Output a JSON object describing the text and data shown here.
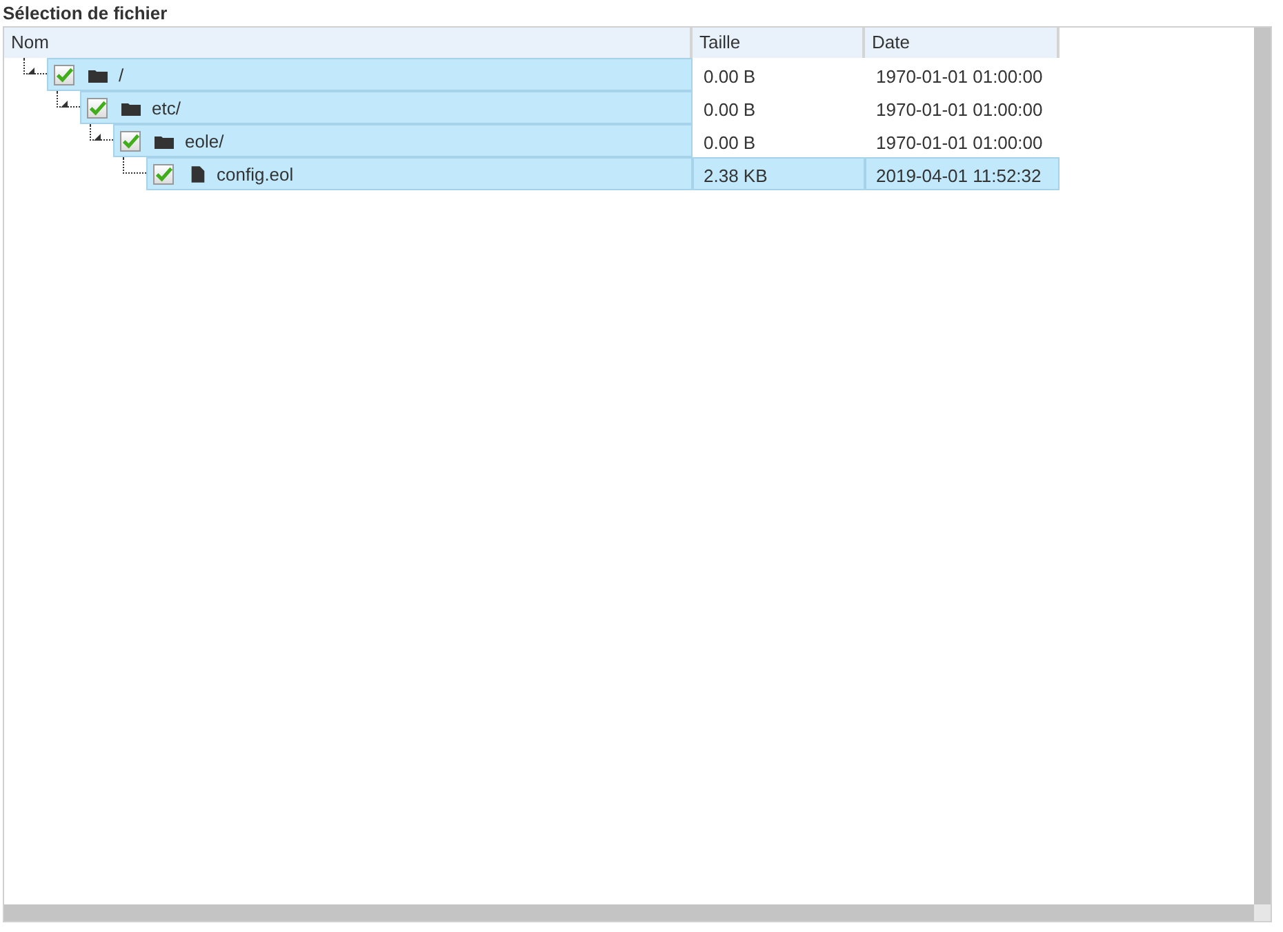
{
  "title": "Sélection de fichier",
  "table": {
    "columns": [
      "Nom",
      "Taille",
      "Date"
    ],
    "tree": [
      {
        "name": "/",
        "kind": "folder",
        "expanded": true,
        "checked": true,
        "selected": false,
        "size": "0.00 B",
        "date": "1970-01-01 01:00:00",
        "children": [
          {
            "name": "etc/",
            "kind": "folder",
            "expanded": true,
            "checked": true,
            "selected": false,
            "size": "0.00 B",
            "date": "1970-01-01 01:00:00",
            "children": [
              {
                "name": "eole/",
                "kind": "folder",
                "expanded": true,
                "checked": true,
                "selected": false,
                "size": "0.00 B",
                "date": "1970-01-01 01:00:00",
                "children": [
                  {
                    "name": "config.eol",
                    "kind": "file",
                    "checked": true,
                    "selected": true,
                    "size": "2.38 KB",
                    "date": "2019-04-01 11:52:32"
                  }
                ]
              }
            ]
          }
        ]
      }
    ]
  }
}
